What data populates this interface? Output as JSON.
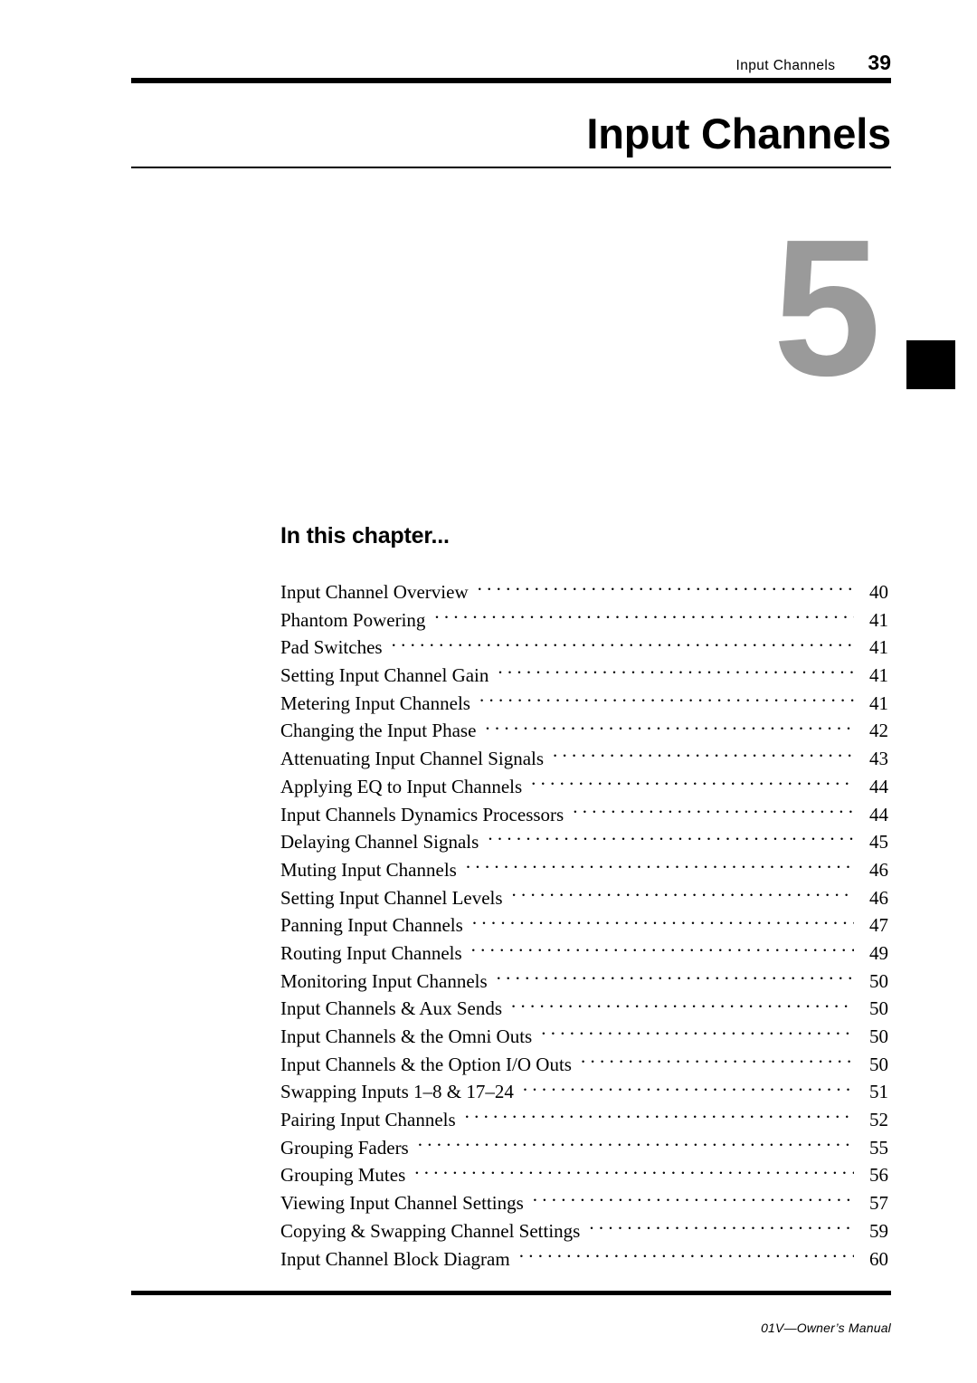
{
  "header": {
    "running_title": "Input Channels",
    "page_number": "39"
  },
  "chapter": {
    "title": "Input Channels",
    "number": "5",
    "tab_color": "#000000",
    "number_color": "#9a9a9a"
  },
  "toc": {
    "heading": "In this chapter...",
    "entries": [
      {
        "label": "Input Channel Overview",
        "page": "40"
      },
      {
        "label": "Phantom Powering",
        "page": "41"
      },
      {
        "label": "Pad Switches",
        "page": "41"
      },
      {
        "label": "Setting Input Channel Gain",
        "page": "41"
      },
      {
        "label": "Metering Input Channels",
        "page": "41"
      },
      {
        "label": "Changing the Input Phase",
        "page": "42"
      },
      {
        "label": "Attenuating Input Channel Signals",
        "page": "43"
      },
      {
        "label": "Applying EQ to Input Channels",
        "page": "44"
      },
      {
        "label": "Input Channels Dynamics Processors",
        "page": "44"
      },
      {
        "label": "Delaying Channel Signals",
        "page": "45"
      },
      {
        "label": "Muting Input Channels",
        "page": "46"
      },
      {
        "label": "Setting Input Channel Levels",
        "page": "46"
      },
      {
        "label": "Panning Input Channels",
        "page": "47"
      },
      {
        "label": "Routing Input Channels",
        "page": "49"
      },
      {
        "label": "Monitoring Input Channels",
        "page": "50"
      },
      {
        "label": "Input Channels & Aux Sends",
        "page": "50"
      },
      {
        "label": "Input Channels & the Omni Outs",
        "page": "50"
      },
      {
        "label": "Input Channels & the Option I/O Outs",
        "page": "50"
      },
      {
        "label": "Swapping Inputs 1–8 & 17–24",
        "page": "51"
      },
      {
        "label": "Pairing Input Channels",
        "page": "52"
      },
      {
        "label": "Grouping Faders",
        "page": "55"
      },
      {
        "label": "Grouping Mutes",
        "page": "56"
      },
      {
        "label": "Viewing Input Channel Settings",
        "page": "57"
      },
      {
        "label": "Copying & Swapping Channel Settings",
        "page": "59"
      },
      {
        "label": "Input Channel Block Diagram",
        "page": "60"
      }
    ]
  },
  "footer": {
    "text": "01V—Owner’s Manual"
  }
}
